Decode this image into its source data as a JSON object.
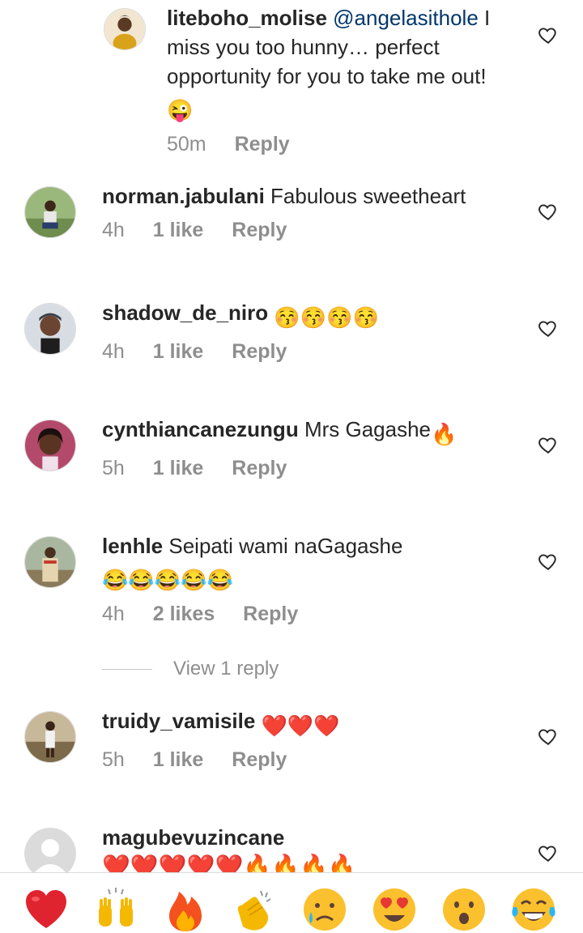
{
  "comments": [
    {
      "username": "liteboho_molise",
      "mention": "@angelasithole",
      "text": " I miss you too hunny… perfect opportunity for you to take me out!",
      "emoji": "😜",
      "time": "50m",
      "likes": "",
      "reply_label": "Reply"
    },
    {
      "username": "norman.jabulani",
      "text": "Fabulous sweetheart",
      "time": "4h",
      "likes": "1 like",
      "reply_label": "Reply"
    },
    {
      "username": "shadow_de_niro",
      "text": "",
      "emoji": "😚😚😚😚",
      "time": "4h",
      "likes": "1 like",
      "reply_label": "Reply"
    },
    {
      "username": "cynthiancanezungu",
      "text": "Mrs Gagashe",
      "emoji": "🔥",
      "time": "5h",
      "likes": "1 like",
      "reply_label": "Reply"
    },
    {
      "username": "lenhle",
      "text": "Seipati wami naGagashe",
      "emoji": "😂😂😂😂😂",
      "time": "4h",
      "likes": "2 likes",
      "reply_label": "Reply"
    },
    {
      "username": "truidy_vamisile",
      "text": "",
      "emoji": "❤️❤️❤️",
      "time": "5h",
      "likes": "1 like",
      "reply_label": "Reply"
    },
    {
      "username": "magubevuzincane",
      "text": "",
      "emoji": "❤️❤️❤️❤️❤️🔥🔥🔥🔥"
    }
  ],
  "view_replies_label": "View 1 reply",
  "reactions": [
    "❤️",
    "🙌",
    "🔥",
    "👏",
    "😢",
    "😍",
    "😮",
    "😂"
  ],
  "colors": {
    "text": "#262626",
    "secondary": "#8e8e8e",
    "mention": "#00376b",
    "heart_red": "#ed4956"
  }
}
